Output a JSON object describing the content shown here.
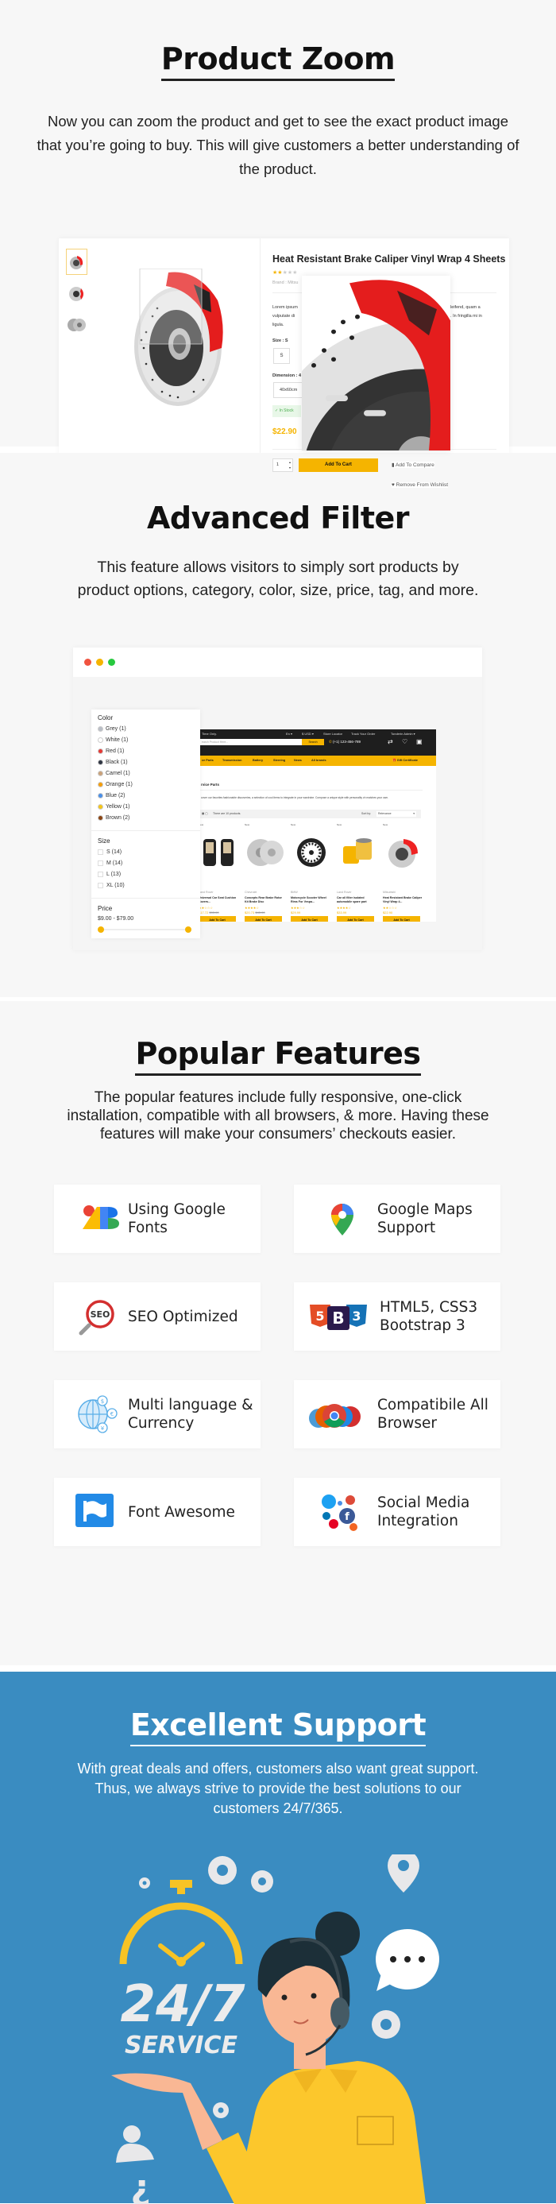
{
  "product_zoom": {
    "title": "Product Zoom",
    "description": "Now you can zoom the product and get to see the exact product image that you’re going to buy. This will give customers a better understanding of the product.",
    "product": {
      "name": "Heat Resistant Brake Caliper Vinyl Wrap 4 Sheets",
      "rating": 2,
      "brand": "Brand : Mitsu",
      "desc_left": "Lorem ipsum",
      "desc_left2": "vulputate di",
      "desc_left3": "ligula.",
      "desc_right": "eleifend, quam a",
      "desc_right2": "n. In fringilla mi in",
      "size_label": "Size : S",
      "size_value": "S",
      "dimension_label": "Dimension : 4",
      "dimension_value": "40x60cm",
      "stock": "In Stock",
      "price": "$22.90",
      "qty": "1",
      "add_to_cart": "Add To Cart",
      "add_to_compare": "Add To Compare",
      "remove_wishlist": "Remove From Wishlist"
    }
  },
  "advanced_filter": {
    "title": "Advanced Filter",
    "description": "This feature allows visitors to simply sort products by product options, category, color, size, price, tag, and more.",
    "window_dots": [
      "#f0533f",
      "#f5b400",
      "#27c93f"
    ],
    "filter": {
      "color_title": "Color",
      "colors": [
        {
          "label": "Grey (1)",
          "hex": "#b9bec7"
        },
        {
          "label": "White (1)",
          "hex": "#ffffff"
        },
        {
          "label": "Red (1)",
          "hex": "#e53935"
        },
        {
          "label": "Black (1)",
          "hex": "#2f3542"
        },
        {
          "label": "Camel (1)",
          "hex": "#c9a27a"
        },
        {
          "label": "Orange (1)",
          "hex": "#f59e0b"
        },
        {
          "label": "Blue (2)",
          "hex": "#4a8fe7"
        },
        {
          "label": "Yellow (1)",
          "hex": "#f5c518"
        },
        {
          "label": "Brown (2)",
          "hex": "#8b4513"
        }
      ],
      "size_title": "Size",
      "sizes": [
        "S (14)",
        "M (14)",
        "L (13)",
        "XL (10)"
      ],
      "price_title": "Price",
      "price_range": "$9.00 - $79.00",
      "price_min": 9,
      "price_max": 79
    },
    "store": {
      "topbar_left": "Time Only.",
      "lang": "En ▾",
      "currency": "$ USD ▾",
      "store_locator": "Store Locator",
      "track_order": "Track Your Order",
      "account": "Tonderin Admin ▾",
      "search_placeholder": "earch Product Here...",
      "search_button": "Search",
      "phone": "(+1) 123-456-789",
      "nav": [
        "ce Parts",
        "Transmission",
        "Battery",
        "Steering",
        "News",
        "All brands"
      ],
      "gift": "Gift Certificate",
      "category_title": "rvice Parts",
      "category_desc": "cover our favorites fashionable discoveries, a selection of cool items to integrate in your wardrobe. Compose a unique style with personality ch matches your own.",
      "count": "There are 10 products.",
      "sort_label": "Sort by:",
      "sort_value": "Relevance",
      "badge_new": "New",
      "products": [
        {
          "brand": "Land Rover",
          "name": "Universal Car Seat Cushion Covers...",
          "stars": "★★☆☆☆",
          "price": "$17.72",
          "old": "$93.00"
        },
        {
          "brand": "Chevrolet",
          "name": "Concepts Rear Brake Rotor Kit Brake Disc",
          "stars": "★★★★☆",
          "price": "$20.73",
          "old": "$45.00"
        },
        {
          "brand": "BMW",
          "name": "Motorcycle Scooter Wheel Rims For Vespa...",
          "stars": "★★★☆☆",
          "price": "$29.99",
          "old": ""
        },
        {
          "brand": "Land Rover",
          "name": "Car oil filter isolated automobile spare part",
          "stars": "★★★★☆",
          "price": "$33.99",
          "old": ""
        },
        {
          "brand": "Mitsubishi",
          "name": "Heat Resistant Brake Caliper Vinyl Wrap 4...",
          "stars": "★★☆☆☆",
          "price": "$22.90",
          "old": ""
        }
      ],
      "add_to_cart": "Add To Cart"
    }
  },
  "popular_features": {
    "title": "Popular Features",
    "description": "The popular features include  fully responsive, one-click installation, compatible with all browsers, & more. Having these features will make your consumers’ checkouts easier.",
    "items": [
      {
        "label": "Using Google Fonts",
        "icon": "google-fonts-icon"
      },
      {
        "label": "Google Maps Support",
        "icon": "google-maps-icon"
      },
      {
        "label": "SEO Optimized",
        "icon": "seo-icon"
      },
      {
        "label": "HTML5, CSS3 Bootstrap 3",
        "icon": "html5-css3-bootstrap-icon"
      },
      {
        "label": "Multi language & Currency",
        "icon": "globe-currency-icon"
      },
      {
        "label": "Compatibile All Browser",
        "icon": "browsers-icon"
      },
      {
        "label": "Font Awesome",
        "icon": "font-awesome-flag-icon"
      },
      {
        "label": "Social Media Integration",
        "icon": "social-media-icon"
      }
    ]
  },
  "support": {
    "title": "Excellent Support",
    "description": "With great deals and offers, customers also want great support. Thus, we always strive to provide the best solutions to our customers 24/7/365.",
    "illustration_text1": "24/7",
    "illustration_text2": "SERVICE",
    "background": "#3a8cc1"
  },
  "colors": {
    "accent": "#f5b400",
    "dark": "#1f1f1f",
    "page_bg": "#f7f7f7"
  }
}
